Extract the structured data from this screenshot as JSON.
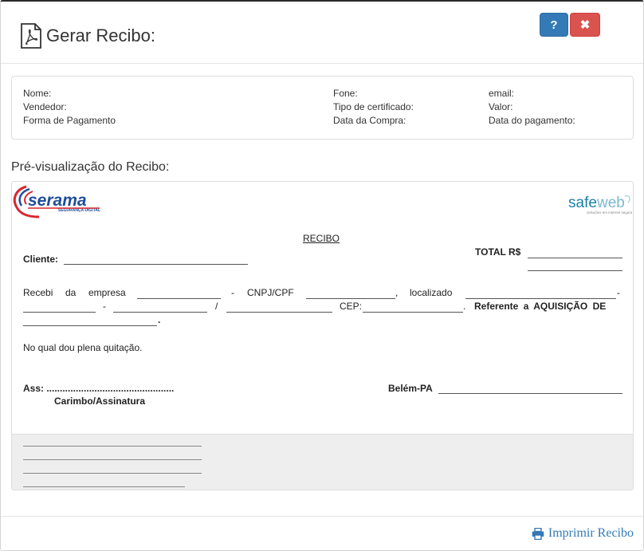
{
  "dialog": {
    "title": "Gerar Recibo:",
    "help_label": "?",
    "close_label": "✖"
  },
  "info": {
    "col1": [
      "Nome:",
      "Vendedor:",
      "Forma de Pagamento"
    ],
    "col2": [
      "Fone:",
      "Tipo de certificado:",
      "Data da Compra:"
    ],
    "col3": [
      "email:",
      "Valor:",
      "Data do pagamento:"
    ]
  },
  "preview": {
    "label": "Pré-visualização do Recibo:",
    "logo_left": "serama",
    "logo_left_sub": "SEGURANÇA DIGITAL",
    "logo_right_a": "safe",
    "logo_right_b": "web",
    "logo_right_sub": "Soluções em internet segura"
  },
  "receipt": {
    "title": "RECIBO",
    "total_label": "TOTAL R$",
    "cliente_label": "Cliente:",
    "recebi": "Recebi",
    "da": "da",
    "empresa": "empresa",
    "dash1": "-",
    "cnpj": "CNPJ/CPF",
    "comma": ",",
    "localizado": "localizado",
    "dash2": "-",
    "dash3": "-",
    "slash": "/",
    "cep": "CEP:",
    "dot1": ".",
    "referente": "Referente a AQUISIÇÃO DE",
    "dot2": ".",
    "quitacao": "No qual dou plena quitação.",
    "ass": "Ass: ................................................",
    "carimbo": "Carimbo/Assinatura",
    "belem": "Belém-PA"
  },
  "footer": {
    "print_label": "Imprimir Recibo"
  },
  "colors": {
    "primary": "#337ab7",
    "danger": "#d9534f"
  }
}
